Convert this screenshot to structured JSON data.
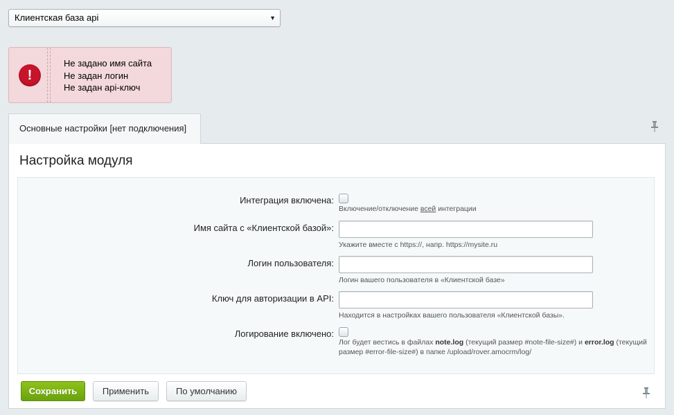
{
  "site_select": {
    "value": "Клиентская база api",
    "arrow": "▼"
  },
  "alert": {
    "icon": "!",
    "messages": [
      "Не задано имя сайта",
      "Не задан логин",
      "Не задан api-ключ"
    ]
  },
  "tab": {
    "label": "Основные настройки [нет подключения]"
  },
  "panel": {
    "title": "Настройка модуля"
  },
  "form": {
    "integration": {
      "label": "Интеграция включена:",
      "checked": false,
      "hint_before": "Включение/отключение ",
      "hint_link": "всей",
      "hint_after": " интеграции"
    },
    "site_name": {
      "label": "Имя сайта с «Клиентской базой»:",
      "value": "",
      "hint": "Укажите вместе с https://, напр. https://mysite.ru"
    },
    "login": {
      "label": "Логин пользователя:",
      "value": "",
      "hint": "Логин вашего пользователя в «Клиентской базе»"
    },
    "api_key": {
      "label": "Ключ для авторизации в API:",
      "value": "",
      "hint": "Находится в настройках вашего пользователя «Клиентской базы»."
    },
    "logging": {
      "label": "Логирование включено:",
      "checked": false,
      "hint_1": "Лог будет вестись в файлах ",
      "hint_file1": "note.log",
      "hint_2": " (текущий размер #note-file-size#) и ",
      "hint_file2": "error.log",
      "hint_3": " (текущий",
      "hint_line2": "размер #error-file-size#) в папке /upload/rover.amocrm/log/"
    }
  },
  "buttons": {
    "save": "Сохранить",
    "apply": "Применить",
    "default": "По умолчанию"
  },
  "icons": {
    "alert": "error-icon",
    "pin": "pin-icon"
  },
  "colors": {
    "save_button": "#7cb213",
    "alert_bg": "#f3d8dc",
    "error_icon": "#c7142a"
  }
}
